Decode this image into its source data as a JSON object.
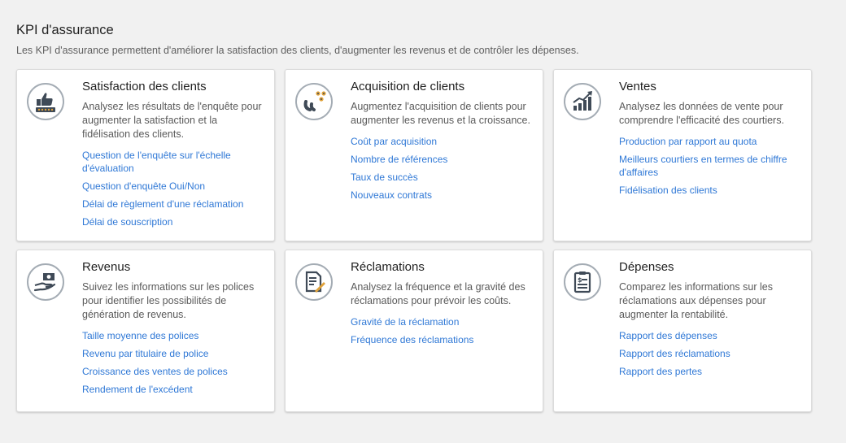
{
  "header": {
    "title": "KPI d'assurance",
    "subtitle": "Les KPI d'assurance permettent d'améliorer la satisfaction des clients, d'augmenter les revenus et de contrôler les dépenses."
  },
  "colors": {
    "background": "#f1f1f1",
    "link": "#2f78d6",
    "icon_ring": "#a4acb4",
    "icon_dark": "#3f4a57",
    "icon_accent": "#e0a23a"
  },
  "cards": [
    {
      "icon": "thumbs-up-rating-icon",
      "title": "Satisfaction des clients",
      "description": "Analysez les résultats de l'enquête pour augmenter la satisfaction et la fidélisation des clients.",
      "links": [
        "Question de l'enquête sur l'échelle d'évaluation",
        "Question d'enquête Oui/Non",
        "Délai de règlement d'une réclamation",
        "Délai de souscription"
      ]
    },
    {
      "icon": "magnet-people-icon",
      "title": "Acquisition de clients",
      "description": "Augmentez l'acquisition de clients pour augmenter les revenus et la croissance.",
      "links": [
        "Coût par acquisition",
        "Nombre de références",
        "Taux de succès",
        "Nouveaux contrats"
      ]
    },
    {
      "icon": "trend-chart-icon",
      "title": "Ventes",
      "description": "Analysez les données de vente pour comprendre l'efficacité des courtiers.",
      "links": [
        "Production par rapport au quota",
        "Meilleurs courtiers en termes de chiffre d'affaires",
        "Fidélisation des clients"
      ]
    },
    {
      "icon": "hand-money-icon",
      "title": "Revenus",
      "description": "Suivez les informations sur les polices pour identifier les possibilités de génération de revenus.",
      "links": [
        "Taille moyenne des polices",
        "Revenu par titulaire de police",
        "Croissance des ventes de polices",
        "Rendement de l'excédent"
      ]
    },
    {
      "icon": "document-pen-icon",
      "title": "Réclamations",
      "description": "Analysez la fréquence et la gravité des réclamations pour prévoir les coûts.",
      "links": [
        "Gravité de la réclamation",
        "Fréquence des réclamations"
      ]
    },
    {
      "icon": "clipboard-dollar-icon",
      "title": "Dépenses",
      "description": "Comparez les informations sur les réclamations aux dépenses pour augmenter la rentabilité.",
      "links": [
        "Rapport des dépenses",
        "Rapport des réclamations",
        "Rapport des pertes"
      ]
    }
  ]
}
